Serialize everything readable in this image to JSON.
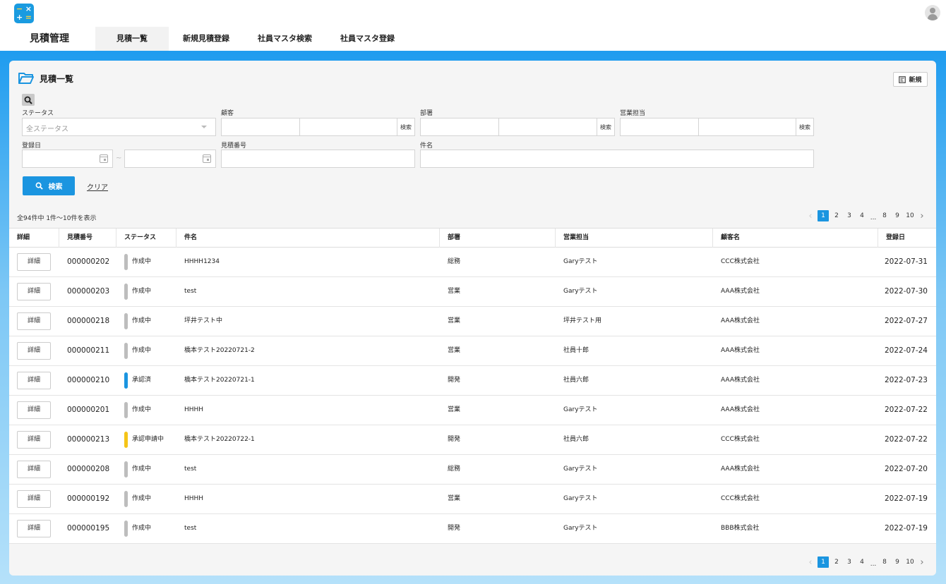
{
  "app": {
    "title": "見積管理",
    "nav_tabs": [
      {
        "label": "見積一覧",
        "active": true
      },
      {
        "label": "新規見積登録"
      },
      {
        "label": "社員マスタ検索"
      },
      {
        "label": "社員マスタ登録"
      }
    ]
  },
  "colors": {
    "accent": "#1b95e0",
    "status_draft": "#bdbdbd",
    "status_approved": "#1b95e0",
    "status_pending": "#f5c518"
  },
  "panel": {
    "title": "見積一覧",
    "new_button": "新規"
  },
  "filters": {
    "status_label": "ステータス",
    "status_placeholder": "全ステータス",
    "customer_label": "顧客",
    "department_label": "部署",
    "sales_label": "営業担当",
    "search_small": "検索",
    "date_label": "登録日",
    "date_separator": "~",
    "quote_no_label": "見積番号",
    "subject_label": "件名",
    "search_button": "検索",
    "clear_link": "クリア"
  },
  "results": {
    "count_text": "全94件中 1件〜10件を表示",
    "pager": {
      "pages": [
        "1",
        "2",
        "3",
        "4",
        "8",
        "9",
        "10"
      ],
      "ellipsis": "...",
      "current": "1"
    }
  },
  "table": {
    "columns": [
      "詳細",
      "見積番号",
      "ステータス",
      "件名",
      "部署",
      "営業担当",
      "顧客名",
      "登録日"
    ],
    "detail_button": "詳細",
    "rows": [
      {
        "no": "000000202",
        "status": "作成中",
        "status_type": "draft",
        "subject": "HHHH1234",
        "dept": "総務",
        "sales": "Garyテスト",
        "customer": "CCC株式会社",
        "date": "2022-07-31"
      },
      {
        "no": "000000203",
        "status": "作成中",
        "status_type": "draft",
        "subject": "test",
        "dept": "営業",
        "sales": "Garyテスト",
        "customer": "AAA株式会社",
        "date": "2022-07-30"
      },
      {
        "no": "000000218",
        "status": "作成中",
        "status_type": "draft",
        "subject": "坪井テスト中",
        "dept": "営業",
        "sales": "坪井テスト用",
        "customer": "AAA株式会社",
        "date": "2022-07-27"
      },
      {
        "no": "000000211",
        "status": "作成中",
        "status_type": "draft",
        "subject": "橋本テスト20220721-2",
        "dept": "営業",
        "sales": "社員十郎",
        "customer": "AAA株式会社",
        "date": "2022-07-24"
      },
      {
        "no": "000000210",
        "status": "承認済",
        "status_type": "approved",
        "subject": "橋本テスト20220721-1",
        "dept": "開発",
        "sales": "社員六郎",
        "customer": "AAA株式会社",
        "date": "2022-07-23"
      },
      {
        "no": "000000201",
        "status": "作成中",
        "status_type": "draft",
        "subject": "HHHH",
        "dept": "営業",
        "sales": "Garyテスト",
        "customer": "AAA株式会社",
        "date": "2022-07-22"
      },
      {
        "no": "000000213",
        "status": "承認申請中",
        "status_type": "pending",
        "subject": "橋本テスト20220722-1",
        "dept": "開発",
        "sales": "社員六郎",
        "customer": "CCC株式会社",
        "date": "2022-07-22"
      },
      {
        "no": "000000208",
        "status": "作成中",
        "status_type": "draft",
        "subject": "test",
        "dept": "総務",
        "sales": "Garyテスト",
        "customer": "AAA株式会社",
        "date": "2022-07-20"
      },
      {
        "no": "000000192",
        "status": "作成中",
        "status_type": "draft",
        "subject": "HHHH",
        "dept": "営業",
        "sales": "Garyテスト",
        "customer": "CCC株式会社",
        "date": "2022-07-19"
      },
      {
        "no": "000000195",
        "status": "作成中",
        "status_type": "draft",
        "subject": "test",
        "dept": "開発",
        "sales": "Garyテスト",
        "customer": "BBB株式会社",
        "date": "2022-07-19"
      }
    ]
  }
}
